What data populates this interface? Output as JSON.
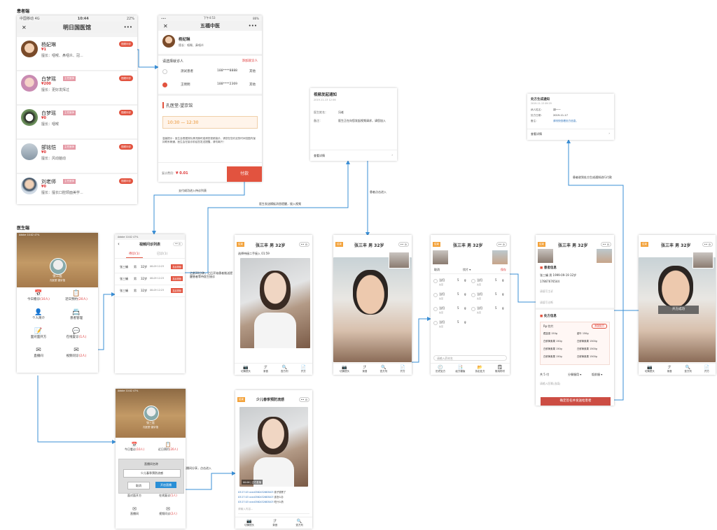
{
  "sections": {
    "patient": "患者端",
    "doctor": "医生端"
  },
  "accent": "#3a8fd6",
  "hospital_screen": {
    "status_left": "中国移动  4G",
    "status_time": "10:44",
    "status_right": "22%",
    "close": "✕",
    "title": "明日国医馆",
    "more": "•••",
    "doctors": [
      {
        "name": "杨妃琳",
        "price": "¥1",
        "skill": "擅长：咽喉、鼻咽炎、冠...",
        "badge": "",
        "btn": "视频问诊"
      },
      {
        "name": "白梦瑶",
        "price": "¥200",
        "skill": "擅长：更好发挥过",
        "badge": "主任医师",
        "btn": "视频问诊"
      },
      {
        "name": "白梦瑶",
        "price": "¥0",
        "skill": "擅长：咽喉",
        "badge": "主任医师",
        "btn": "视频问诊"
      },
      {
        "name": "郜铭恺",
        "price": "¥0",
        "skill": "擅长：风动脑动",
        "badge": "主任医师",
        "btn": "视频问诊"
      },
      {
        "name": "刘老师",
        "price": "¥0",
        "skill": "擅长：擅长口腔颌面美学...",
        "badge": "主任医师",
        "btn": "视频问诊"
      }
    ]
  },
  "booking_screen": {
    "status_time": "下午4:53",
    "status_right": "86%",
    "close": "✕",
    "title": "五福中医",
    "more": "•••",
    "doctor_name": "杨妃琳",
    "doctor_skill": "擅长：咽喉、鼻咽炎",
    "choose_label": "请选择就诊人",
    "add_label": "添加就诊人",
    "patients": [
      {
        "name": "测试患者",
        "phone": "188****8888",
        "rel": "其他"
      },
      {
        "name": "王明明",
        "phone": "188****2369",
        "rel": "其他"
      }
    ],
    "clinic": "孔医堂-望京馆",
    "time_slot": "10:30 — 12:30",
    "tip": "温馨提示：医生会根据排队情况随时邀请您视频接诊，请您在您约定的时间范围内保持联系畅通，医生会在接诊前给您发送提醒，请勿离开！",
    "fee_label": "复诊费用：",
    "fee": "¥ 0.01",
    "pay": "付款"
  },
  "notice_video": {
    "title": "视频发起通知",
    "date": "2019-11-13 12:56",
    "row1_label": "医生姓名：",
    "row1_val": "冯老",
    "row2_label": "备注：",
    "row2_val": "医生正在向您发起视频请求，请您加入",
    "link": "查看详情",
    "arrow": "›"
  },
  "notice_rx": {
    "title": "处方生成通知",
    "date": "2019-11-13 09:29",
    "rows": [
      {
        "label": "病人姓名：",
        "val": "胡一一"
      },
      {
        "label": "处方日期：",
        "val": "2019-11-17"
      },
      {
        "label": "备注：",
        "val": "请尽快查看处方信息。"
      }
    ],
    "link": "查看详情",
    "arrow": "›"
  },
  "flow_labels": {
    "pay_success": "支付成功进入待诊列表",
    "doctor_notify": "医生发送模板消息提醒，接入视频",
    "patient_click": "患者点击进入",
    "rx_notify": "患者收到处方生成通知进行付款",
    "five_min": "之前30分钟，之后开始患者推送提醒患者等待医生接诊",
    "live_share": "直播间分享，点击进入"
  },
  "doc_home": {
    "status": "Adobe  10:02  47%",
    "name": "张三医",
    "hospital": "孔医堂·望京馆",
    "menus": [
      {
        "icon": "📅",
        "label": "今日看诊",
        "count": "(10人)"
      },
      {
        "icon": "📋",
        "label": "近日预约",
        "count": "(20人)"
      },
      {
        "icon": "👤",
        "label": "个人简介",
        "count": ""
      },
      {
        "icon": "📇",
        "label": "患者管理",
        "count": ""
      },
      {
        "icon": "📝",
        "label": "面对面开方",
        "count": ""
      },
      {
        "icon": "💬",
        "label": "在线复诊",
        "count": "(1人)"
      },
      {
        "icon": "✉",
        "label": "直播间",
        "count": ""
      },
      {
        "icon": "✉",
        "label": "视频问诊",
        "count": "(2人)"
      }
    ]
  },
  "doc_queue": {
    "status": "Adobe  10:02  47%",
    "back": "‹",
    "title": "视频问诊列表",
    "tab1": "待诊(1)",
    "tab2": "已诊(1)",
    "rows": [
      {
        "name": "张三蛹",
        "sex": "男",
        "age": "32岁",
        "date": "08-09 12:23",
        "btn": "发起视频"
      },
      {
        "name": "张三蛹",
        "sex": "男",
        "age": "32岁",
        "date": "08-09 12:23",
        "btn": "发起视频"
      },
      {
        "name": "张三蛹",
        "sex": "男",
        "age": "32岁",
        "date": "08-09 12:23",
        "btn": "发起视频"
      }
    ]
  },
  "call_waiting": {
    "tag": "结束",
    "title": "张三丰 男 32岁",
    "subtitle": "选择待接二手接入 01:59",
    "tools": [
      "切换镜头",
      "录音",
      "查方剂",
      "开方"
    ]
  },
  "call_connected": {
    "tag": "结束",
    "title": "张三丰 男 32岁",
    "tools": [
      "切换镜头",
      "录音",
      "查方剂",
      "开方"
    ]
  },
  "call_rx": {
    "tag": "结束",
    "title": "张三丰 男 32岁",
    "head_left": "取消",
    "head_mid": "饮片 ▾",
    "head_right": "保存",
    "herbs": [
      {
        "name": "当归",
        "sub": "先煎",
        "qty": "5",
        "unit": "g"
      },
      {
        "name": "当归",
        "sub": "先煎",
        "qty": "5",
        "unit": "g"
      },
      {
        "name": "当归",
        "sub": "先煎",
        "qty": "5",
        "unit": "g"
      },
      {
        "name": "当归",
        "sub": "先煎",
        "qty": "5",
        "unit": "g"
      },
      {
        "name": "当归",
        "sub": "先煎",
        "qty": "5",
        "unit": "g"
      },
      {
        "name": "当归",
        "sub": "先煎",
        "qty": "5",
        "unit": "g"
      },
      {
        "name": "当归",
        "sub": "先煎",
        "qty": "5",
        "unit": "g"
      }
    ],
    "input_placeholder": "请输入药材名",
    "tools": [
      "历史处方",
      "经方模版",
      "协定处方",
      "常用药材"
    ]
  },
  "call_rx_form": {
    "tag": "结束",
    "title": "张三丰 男 32岁",
    "section1": "患者信息",
    "patient_line": "张三蛹  男   1999-09-19  32岁",
    "phone": "17867676544",
    "fld1": "请填写主诉",
    "fld2": "请填写诊断",
    "section2": "处方信息",
    "rx_type": "Rp:饮片",
    "rx_btn": "添加处方",
    "drugs": [
      [
        "藏金香 150g",
        "甜叶 150g"
      ],
      [
        "白鲜黄素果 150g",
        "白鲜黄素果 1500g"
      ],
      [
        "白鲜黄素果 150g",
        "白鲜黄素果 1500g"
      ],
      [
        "白鲜黄素果 150g",
        "白鲜黄素果 1500g"
      ]
    ],
    "dose": "共   5  付",
    "usage": "分餐服用 ▾",
    "method": "饭前服 ▾",
    "advice": "请输入医嘱(选填)",
    "submit": "确定签名并发送给患者"
  },
  "call_end": {
    "tag": "结束",
    "title": "张三丰 男 32岁",
    "btn": "开方成功",
    "tools": [
      "切换镜头",
      "录音",
      "查方剂",
      "开方"
    ]
  },
  "live_setup": {
    "status": "Adobe  10:02  47%",
    "name": "张三医",
    "hospital": "孔医堂·望京馆",
    "dialog_title": "直播间名称",
    "dialog_value": "少儿春季预防流感",
    "cancel": "取消",
    "start": "开启直播",
    "menus": [
      {
        "label": "今日看诊",
        "count": "(10人)"
      },
      {
        "label": "近日预约",
        "count": "(20人)"
      },
      {
        "label": "面对面开方",
        "count": ""
      },
      {
        "label": "在线复诊",
        "count": "(1人)"
      },
      {
        "label": "直播间",
        "count": ""
      },
      {
        "label": "视频问诊",
        "count": "(2人)"
      }
    ]
  },
  "live_room": {
    "tag": "结束",
    "title": "少儿春季预防流感",
    "overlay": "00:06 | 正在直播",
    "chats": [
      {
        "user": "03:27:03 xcxc0560432683007:",
        "msg": "孩子感冒了"
      },
      {
        "user": "03:27:03 xcxc0560432683007:",
        "msg": "该怎么办"
      },
      {
        "user": "03:27:03 xcxc0560432683007:",
        "msg": "吃什么药"
      }
    ],
    "input": "请输入内容...",
    "tools": [
      "切换镜头",
      "录音",
      "查方剂"
    ]
  }
}
